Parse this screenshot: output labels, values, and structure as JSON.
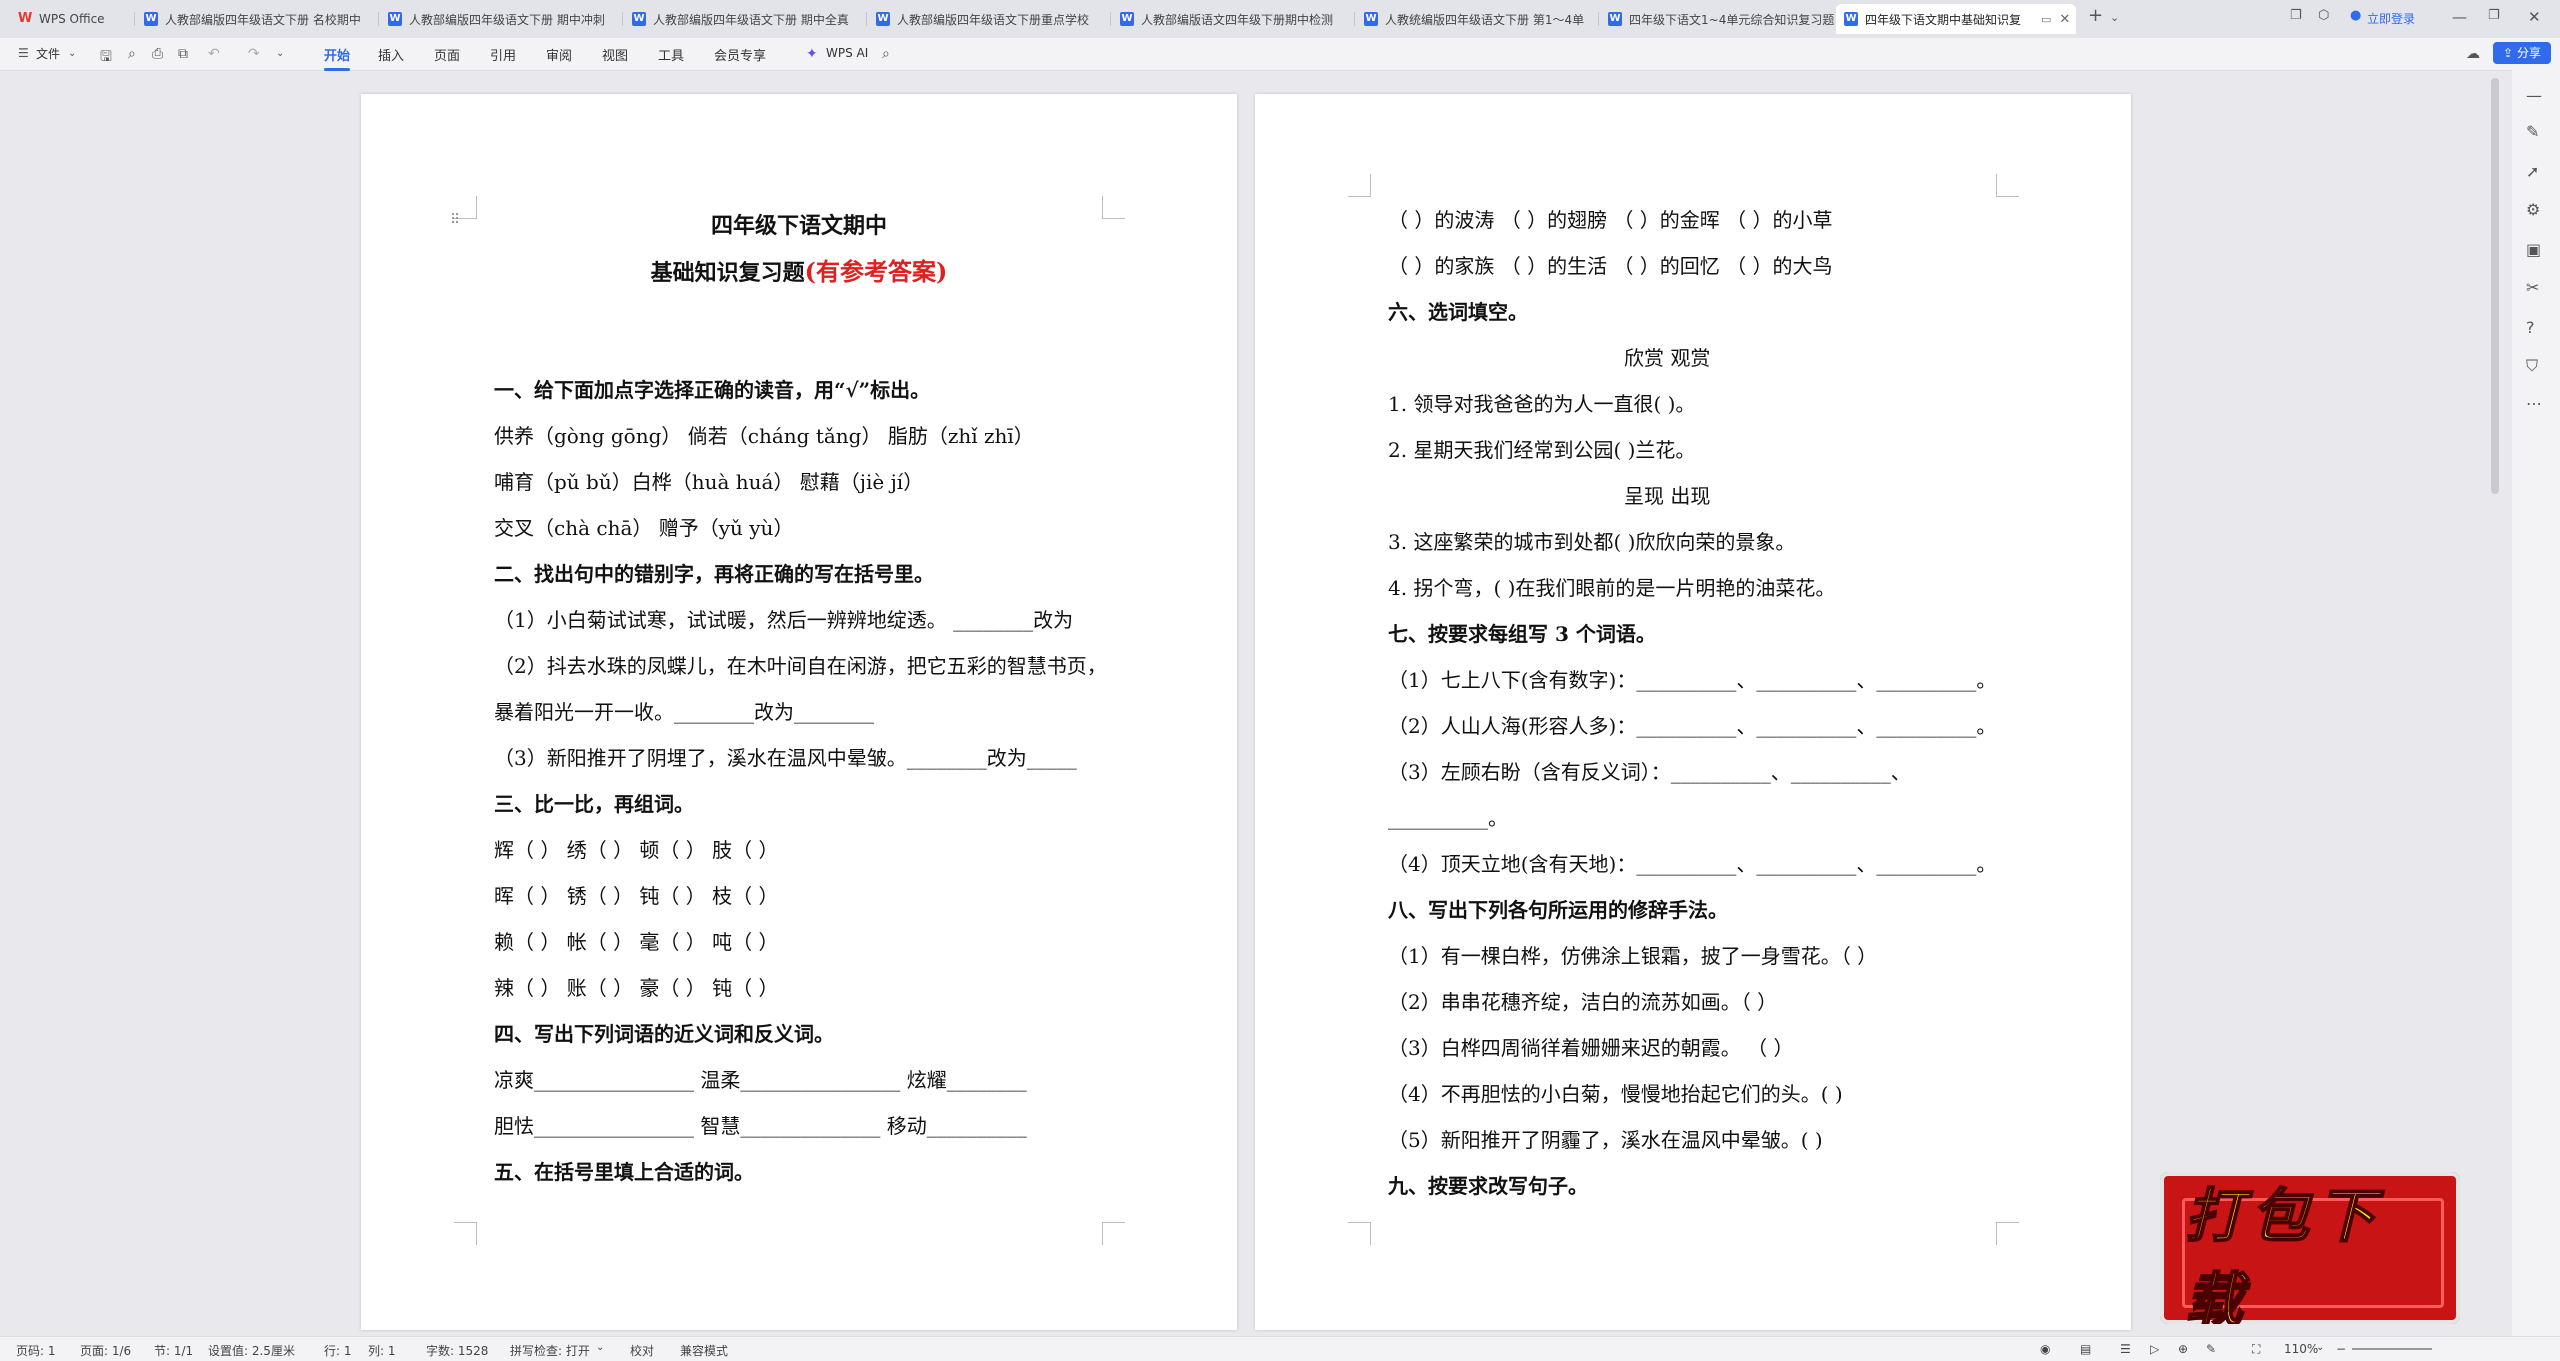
{
  "tabs": [
    {
      "label": "WPS Office",
      "icon": "wps-logo-icon"
    },
    {
      "label": "人教部编版四年级语文下册 名校期中"
    },
    {
      "label": "人教部编版四年级语文下册 期中冲刺"
    },
    {
      "label": "人教部编版四年级语文下册 期中全真"
    },
    {
      "label": "人教部编版四年级语文下册重点学校"
    },
    {
      "label": "人教部编版语文四年级下册期中检测"
    },
    {
      "label": "人教统编版四年级语文下册 第1～4单"
    },
    {
      "label": "四年级下语文1~4单元综合知识复习题"
    },
    {
      "label": "四年级下语文期中基础知识复"
    }
  ],
  "titlebar": {
    "login": "立即登录"
  },
  "toolbar": {
    "file": "文件",
    "menus": [
      "开始",
      "插入",
      "页面",
      "引用",
      "审阅",
      "视图",
      "工具",
      "会员专享"
    ],
    "ai": "WPS AI",
    "share": "分享"
  },
  "page1": {
    "title1": "四年级下语文期中",
    "title2a": "基础知识复习题",
    "title2b": "(有参考答案)",
    "lines": [
      "一、给下面加点字选择正确的读音，用“√”标出。",
      "供养（gòng gōng）   倘若（cháng tǎng）   脂肪（zhǐ zhī）",
      "哺育（pǔ bǔ）白桦（huà huá）    慰藉（jiè jí）",
      "交叉（chà chā）   赠予（yǔ yù）",
      "二、找出句中的错别字，再将正确的写在括号里。",
      "（1）小白菊试试寒，试试暖，然后一辨辨地绽透。 ________改为",
      "（2）抖去水珠的凤蝶儿，在木叶间自在闲游，把它五彩的智慧书页，",
      "暴着阳光一开一收。________改为________",
      "（3）新阳推开了阴埋了，溪水在温风中晕皱。________改为_____",
      "三、比一比，再组词。",
      "辉（        ）   绣（        ）   顿（        ）   肢（        ）",
      "晖（        ）   锈（        ）   钝（        ）   枝（        ）",
      "赖（     ）     帐（     ）     毫（     ）     吨（     ）",
      "辣（     ）     账（     ）     豪（     ）     钝（     ）",
      "四、写出下列词语的近义词和反义词。",
      "凉爽________________  温柔________________  炫耀________",
      "胆怯________________  智慧______________  移动__________",
      "五、在括号里填上合适的词。"
    ]
  },
  "page2": {
    "lines": [
      "（    ）的波涛  （    ）的翅膀   （    ）的金晖   （    ）的小草",
      "（    ）的家族  （    ）的生活   （    ）的回忆   （    ）的大鸟",
      "六、选词填空。",
      "欣赏    观赏",
      "1. 领导对我爸爸的为人一直很(          )。",
      "2. 星期天我们经常到公园(          )兰花。",
      "呈现    出现",
      "3. 这座繁荣的城市到处都(          )欣欣向荣的景象。",
      "4. 拐个弯，(          )在我们眼前的是一片明艳的油菜花。",
      "七、按要求每组写 3 个词语。",
      "（1）七上八下(含有数字)：__________、__________、__________。",
      "（2）人山人海(形容人多)：__________、__________、__________。",
      "（3）左顾右盼（含有反义词）：__________、__________、",
      "__________。",
      "（4）顶天立地(含有天地)：__________、__________、__________。",
      "八、写出下列各句所运用的修辞手法。",
      "（1）有一棵白桦，仿佛涂上银霜，披了一身雪花。（          ）",
      "（2）串串花穗齐绽，洁白的流苏如画。（          ）",
      "（3）白桦四周徜徉着姗姗来迟的朝霞。       （          ）",
      "（4）不再胆怯的小白菊，慢慢地抬起它们的头。(          )",
      "（5）新阳推开了阴霾了，溪水在温风中晕皱。(          )",
      "九、按要求改写句子。"
    ]
  },
  "statusbar": {
    "page": "页码: 1",
    "pages": "页面: 1/6",
    "section": "节: 1/1",
    "setting": "设置值: 2.5厘米",
    "row": "行: 1",
    "col": "列: 1",
    "words": "字数: 1528",
    "spell": "拼写检查: 打开",
    "proof": "校对",
    "compat": "兼容模式",
    "zoom": "110%"
  },
  "badge": {
    "text": "打包下载"
  }
}
